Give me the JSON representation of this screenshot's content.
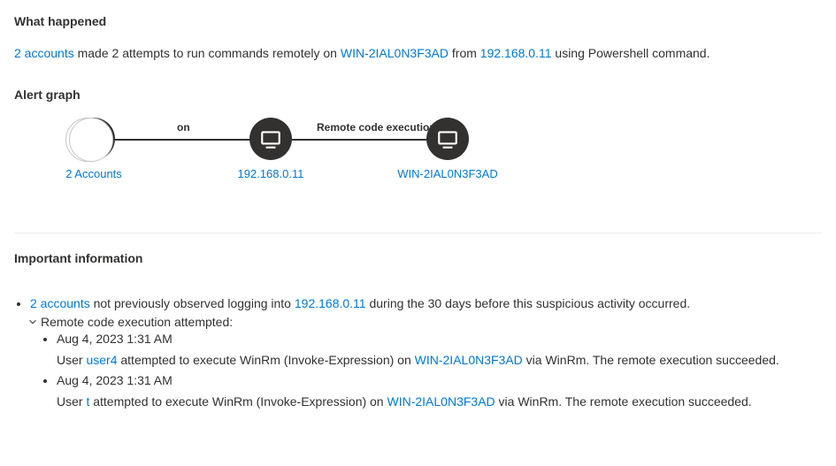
{
  "what_happened": {
    "title": "What happened",
    "accounts_link": "2 accounts",
    "text_1": " made 2 attempts to run commands remotely on ",
    "host_link": "WIN-2IAL0N3F3AD",
    "text_2": " from ",
    "ip_link": "192.168.0.11",
    "text_3": " using Powershell command."
  },
  "graph": {
    "title": "Alert graph",
    "node_accounts": "2 Accounts",
    "node_ip": "192.168.0.11",
    "node_host": "WIN-2IAL0N3F3AD",
    "edge_on": "on",
    "edge_rce": "Remote code execution"
  },
  "important": {
    "title": "Important information",
    "accounts_link": "2 accounts",
    "text_logging": " not previously observed logging into ",
    "ip_link": "192.168.0.11",
    "text_during": " during the 30 days before this suspicious activity occurred.",
    "rce_attempted": "Remote code execution attempted:",
    "events": [
      {
        "timestamp": "Aug 4, 2023 1:31 AM",
        "pre_user": "User ",
        "user": "user4",
        "pre_host": " attempted to execute WinRm (Invoke-Expression) on ",
        "host": "WIN-2IAL0N3F3AD",
        "post": " via WinRm. The remote execution succeeded."
      },
      {
        "timestamp": "Aug 4, 2023 1:31 AM",
        "pre_user": "User ",
        "user": "t",
        "pre_host": " attempted to execute WinRm (Invoke-Expression) on ",
        "host": "WIN-2IAL0N3F3AD",
        "post": " via WinRm. The remote execution succeeded."
      }
    ]
  }
}
